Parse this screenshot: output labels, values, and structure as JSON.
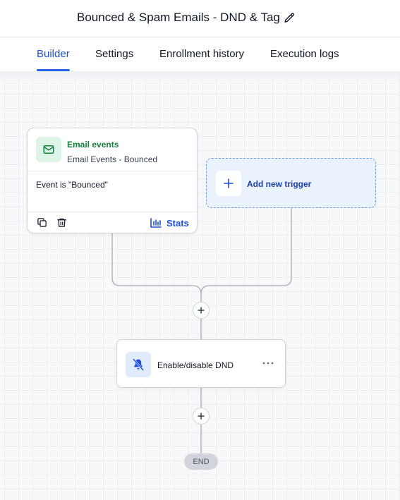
{
  "header": {
    "title": "Bounced & Spam Emails - DND & Tag"
  },
  "tabs": [
    {
      "label": "Builder",
      "active": true
    },
    {
      "label": "Settings",
      "active": false
    },
    {
      "label": "Enrollment history",
      "active": false
    },
    {
      "label": "Execution logs",
      "active": false
    }
  ],
  "trigger": {
    "icon": "mail-icon",
    "name": "Email events",
    "subtitle": "Email Events - Bounced",
    "condition": "Event is \"Bounced\"",
    "stats_label": "Stats"
  },
  "add_trigger": {
    "label": "Add new trigger"
  },
  "action": {
    "icon": "bell-off-icon",
    "label": "Enable/disable DND"
  },
  "end_label": "END",
  "colors": {
    "accent": "#1d4ed8",
    "trigger_green": "#15803d",
    "add_trigger_bg": "#eaf2fe"
  }
}
